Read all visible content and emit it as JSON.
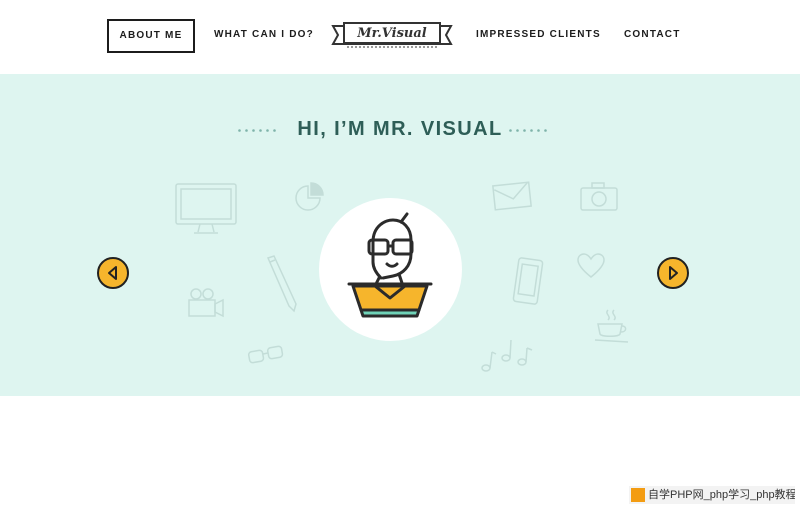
{
  "nav": {
    "items": [
      {
        "label": "ABOUT ME",
        "active": true
      },
      {
        "label": "WHAT CAN I DO?",
        "active": false
      },
      {
        "label": "IMPRESSED CLIENTS",
        "active": false
      },
      {
        "label": "CONTACT",
        "active": false
      }
    ],
    "logo_text": "Mr.Visual"
  },
  "hero": {
    "title": "HI, I’M MR. VISUAL",
    "background_color": "#def5f0",
    "title_color": "#2e5e57",
    "background_icons": [
      "monitor-icon",
      "pie-chart-icon",
      "pencil-icon",
      "video-camera-icon",
      "glasses-icon",
      "envelope-icon",
      "camera-icon",
      "phone-icon",
      "heart-icon",
      "coffee-cup-icon",
      "music-notes-icon"
    ],
    "avatar": "mr-visual-character",
    "prev_arrow_icon": "chevron-left-icon",
    "next_arrow_icon": "chevron-right-icon",
    "accent_color": "#f6b52c"
  },
  "watermark": {
    "text": "自学PHP网_php学习_php教程"
  }
}
